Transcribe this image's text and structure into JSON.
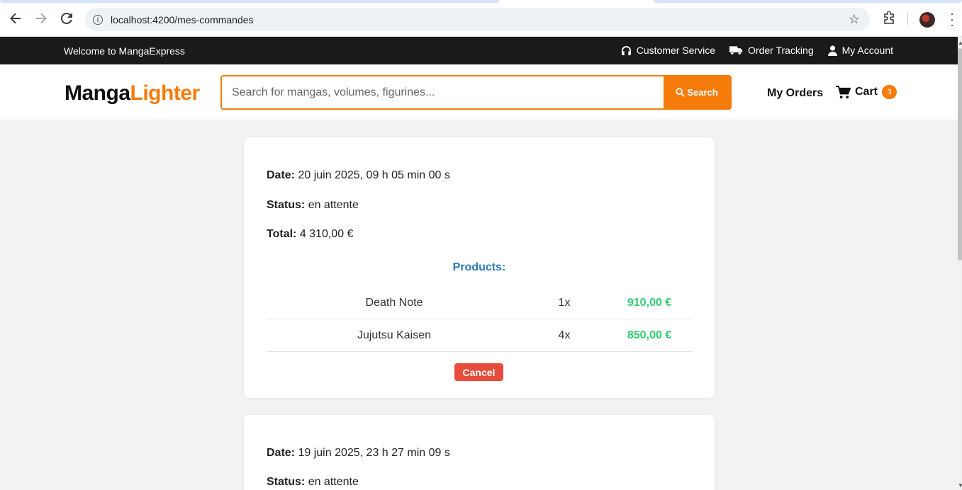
{
  "browser": {
    "url": "localhost:4200/mes-commandes"
  },
  "topbar": {
    "welcome": "Welcome to MangaExpress",
    "links": [
      {
        "label": "Customer Service",
        "icon": "headset-icon"
      },
      {
        "label": "Order Tracking",
        "icon": "truck-icon"
      },
      {
        "label": "My Account",
        "icon": "user-icon"
      }
    ]
  },
  "header": {
    "logo_part1": "Manga",
    "logo_part2": "Lighter",
    "search_placeholder": "Search for mangas, volumes, figurines...",
    "search_button": "Search",
    "my_orders": "My Orders",
    "cart_label": "Cart",
    "cart_count": "3"
  },
  "labels": {
    "date": "Date:",
    "status": "Status:",
    "total": "Total:",
    "products": "Products:",
    "cancel": "Cancel"
  },
  "orders": [
    {
      "date": "20 juin 2025, 09 h 05 min 00 s",
      "status": "en attente",
      "total": "4 310,00 €",
      "products": [
        {
          "name": "Death Note",
          "qty": "1x",
          "price": "910,00 €"
        },
        {
          "name": "Jujutsu Kaisen",
          "qty": "4x",
          "price": "850,00 €"
        }
      ]
    },
    {
      "date": "19 juin 2025, 23 h 27 min 09 s",
      "status": "en attente"
    }
  ],
  "colors": {
    "accent": "#f57c0a",
    "topbar": "#1a1a1a",
    "products_title": "#2a7ab8",
    "price": "#2ecc71",
    "cancel": "#e74c3c"
  }
}
